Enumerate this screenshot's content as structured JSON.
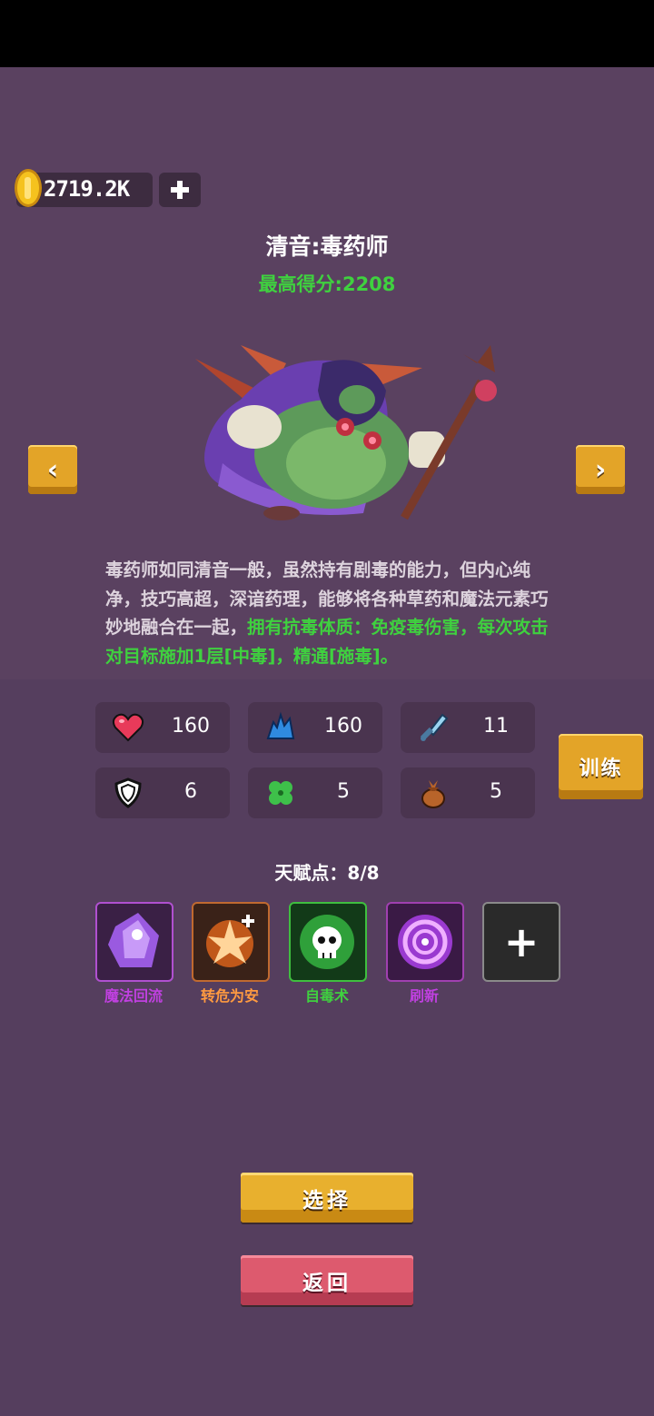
{
  "currency": {
    "amount": "2719.2K",
    "add_label": "+"
  },
  "hero": {
    "title": "清音:毒药师",
    "best_score": "最高得分:2208"
  },
  "nav": {
    "prev": "‹",
    "next": "›"
  },
  "description": {
    "normal": "毒药师如同清音一般，虽然持有剧毒的能力，但内心纯净，技巧高超，深谙药理，能够将各种草药和魔法元素巧妙地融合在一起，",
    "highlight": "拥有抗毒体质：免疫毒伤害，每次攻击对目标施加1层[中毒]，精通[施毒]。"
  },
  "stats": [
    {
      "icon": "heart-icon",
      "value": "160"
    },
    {
      "icon": "energy-icon",
      "value": "160"
    },
    {
      "icon": "sword-icon",
      "value": "11"
    },
    {
      "icon": "shield-icon",
      "value": "6"
    },
    {
      "icon": "clover-icon",
      "value": "5"
    },
    {
      "icon": "pouch-icon",
      "value": "5"
    }
  ],
  "train_label": "训练",
  "talent": {
    "label": "天赋点：8/8"
  },
  "skills": [
    {
      "name": "魔法回流",
      "color": "#c040e0",
      "border": "#b050d0"
    },
    {
      "name": "转危为安",
      "color": "#ff9a40",
      "border": "#c06a30"
    },
    {
      "name": "自毒术",
      "color": "#3fd13f",
      "border": "#3fbf3f"
    },
    {
      "name": "刷新",
      "color": "#c040e0",
      "border": "#a040b0"
    }
  ],
  "add_skill": "+",
  "buttons": {
    "select": "选择",
    "back": "返回"
  }
}
